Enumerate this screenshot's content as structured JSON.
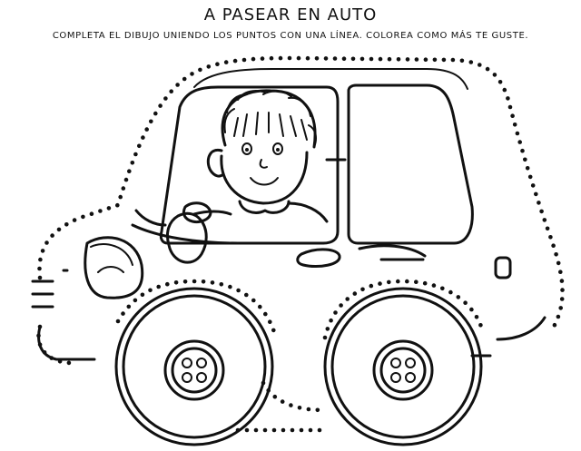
{
  "worksheet": {
    "title": "A PASEAR EN AUTO",
    "instructions": "COMPLETA EL DIBUJO UNIENDO LOS PUNTOS CON UNA LÍNEA. COLOREA COMO MÁS TE GUSTE."
  },
  "illustration": {
    "subject": "car with boy at the wheel",
    "icons": [
      "car-outline-dots",
      "boy-driver",
      "steering-wheel",
      "headlight",
      "front-wheel",
      "rear-wheel",
      "door-handle",
      "windows"
    ]
  },
  "colors": {
    "ink": "#111111",
    "paper": "#ffffff"
  }
}
